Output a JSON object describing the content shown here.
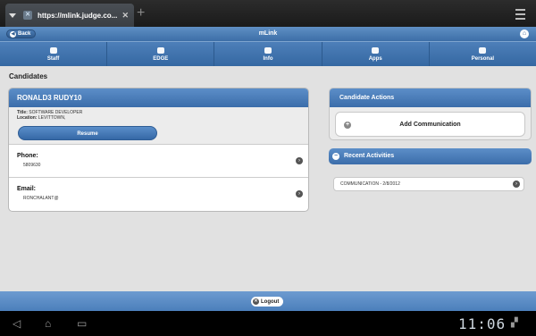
{
  "browser": {
    "tab_title": "https://mlink.judge.co...",
    "close_glyph": "✕",
    "new_tab_glyph": "+"
  },
  "header": {
    "back_label": "Back",
    "title": "mLink"
  },
  "nav": {
    "items": [
      {
        "label": "Staff",
        "icon": "staff-icon"
      },
      {
        "label": "EDGE",
        "icon": "edge-icon"
      },
      {
        "label": "Info",
        "icon": "info-icon"
      },
      {
        "label": "Apps",
        "icon": "apps-icon"
      },
      {
        "label": "Personal",
        "icon": "personal-icon"
      }
    ]
  },
  "page": {
    "section_title": "Candidates"
  },
  "candidate": {
    "name": "RONALD3 RUDY10",
    "title_label": "Title:",
    "title_value": "SOFTWARE DEVELOPER",
    "location_label": "Location:",
    "location_value": "LEVITTOWN,",
    "resume_label": "Resume",
    "phone_label": "Phone:",
    "phone_value": "5809630",
    "email_label": "Email:",
    "email_value": "RONCHALANT@"
  },
  "actions": {
    "title": "Candidate Actions",
    "add_communication_label": "Add Communication"
  },
  "recent": {
    "title": "Recent Activities",
    "items": [
      {
        "label": "COMMUNICATION - 2/8/2012"
      }
    ]
  },
  "footer": {
    "logout_label": "Logout"
  },
  "system": {
    "clock": "11:06"
  },
  "colors": {
    "brand_blue": "#3b6daa",
    "background": "#e1e1e1"
  }
}
